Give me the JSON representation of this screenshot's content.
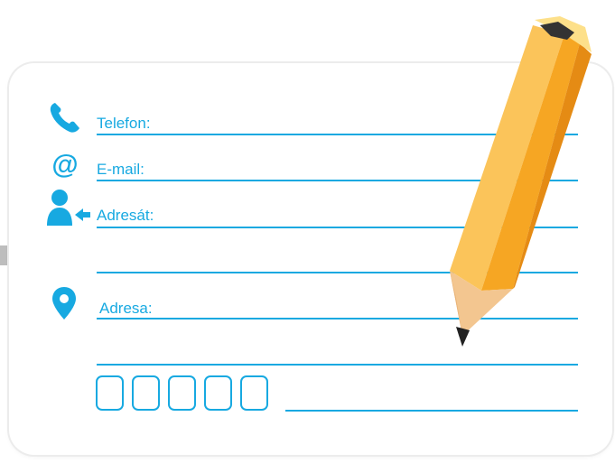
{
  "form": {
    "phone_label": "Telefon:",
    "email_label": "E-mail:",
    "recipient_label": "Adresát:",
    "address_label": "Adresa:",
    "postal_code_boxes": [
      "",
      "",
      "",
      "",
      ""
    ]
  },
  "icons": {
    "phone": "phone-icon",
    "email": "at-sign-icon",
    "recipient": "user-arrow-icon",
    "address": "map-pin-icon",
    "pencil": "pencil-icon"
  },
  "colors": {
    "accent": "#17a9e1",
    "pencil_body": "#f6a623",
    "pencil_light": "#fbc45a",
    "pencil_dark": "#e58b14",
    "wood": "#f3c690",
    "card_border": "#ececec"
  }
}
